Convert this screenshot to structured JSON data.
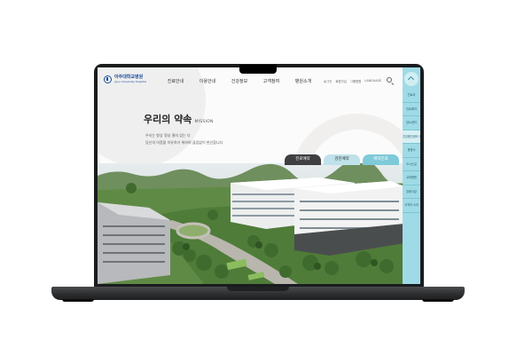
{
  "header": {
    "logo": {
      "name_ko": "아주대학교병원",
      "name_en": "Ajou University Hospital"
    },
    "nav": [
      {
        "label": "진료안내"
      },
      {
        "label": "이용안내"
      },
      {
        "label": "건강정보"
      },
      {
        "label": "고객참여"
      },
      {
        "label": "병원소개"
      }
    ],
    "util_links": [
      "로그인",
      "회원가입",
      "그룹병원",
      "LANGUAGE"
    ],
    "search_icon": "search-icon"
  },
  "hero": {
    "title": "우리의 약속",
    "title_en": "MISSION",
    "lines": [
      "우리는 항상 정성 결의 있는 다",
      "당신의 아픔을 치유하기 위하여 끊임없이 헌신합니다"
    ]
  },
  "tabs": [
    {
      "label": "진료예약"
    },
    {
      "label": "검진예약"
    },
    {
      "label": "예약진료"
    }
  ],
  "quick_menu": {
    "top_icon": "chevron-up-icon",
    "items": [
      {
        "label": "진료과"
      },
      {
        "label": "진료예약"
      },
      {
        "label": "당뇨센터"
      },
      {
        "label": "건강증진센터 신청"
      },
      {
        "label": "증명서"
      },
      {
        "label": "오시는길"
      },
      {
        "label": "교대병원"
      },
      {
        "label": "장례식장"
      },
      {
        "label": "고객의 소리"
      }
    ]
  },
  "colors": {
    "quick_bg": "#9fdbe6",
    "tab_active": "#3f3f42",
    "tab_light": "#bfe2ea",
    "tab_mid": "#7fcad9",
    "brand": "#1e4f9c"
  }
}
